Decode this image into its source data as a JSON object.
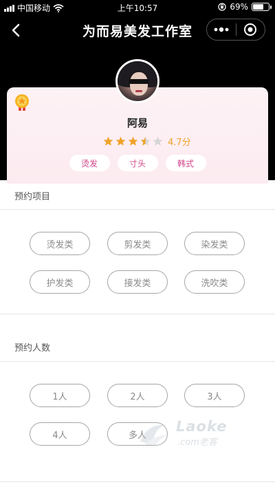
{
  "status_bar": {
    "carrier": "中国移动",
    "time": "上午10:57",
    "battery": "69%",
    "battery_level": 0.69
  },
  "nav": {
    "title": "为而易美发工作室",
    "back_icon": "chevron-left-icon",
    "more_icon": "more-dots-icon",
    "close_icon": "target-circle-icon"
  },
  "profile": {
    "name": "阿易",
    "rating": 4.7,
    "stars_full": 3,
    "stars_half": 1,
    "stars_total": 5,
    "score_label": "4.7分",
    "tags": [
      "烫发",
      "寸头",
      "韩式"
    ],
    "badge_icon": "medal-icon"
  },
  "services": {
    "title": "预约项目",
    "options": [
      "烫发类",
      "剪发类",
      "染发类",
      "护发类",
      "接发类",
      "洗吹类"
    ]
  },
  "people": {
    "title": "预约人数",
    "options": [
      "1人",
      "2人",
      "3人",
      "4人",
      "多人"
    ]
  },
  "watermark": {
    "brand": "Laoke",
    "sub": ".com老客"
  },
  "colors": {
    "tag_text": "#d2478a",
    "star": "#f0a22a",
    "card_bg": "#fdf2f5"
  }
}
